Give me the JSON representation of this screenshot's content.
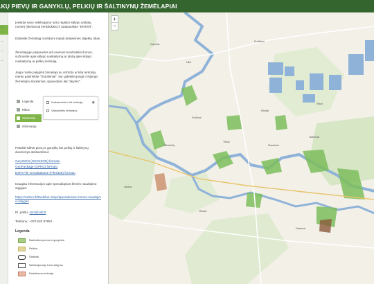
{
  "header": {
    "title": "...KŲ PIEVŲ IR GANYKLŲ, PELKIŲ IR ŠALTINYNŲ ŽEMĖLAPIAI"
  },
  "side_tabs": [
    "...",
    "...",
    "...",
    "..."
  ],
  "sidebar": {
    "p1": "Įveskite savo nekilnojamo turto registro sklypo unikalų numerį (skiriamoji ženkliukais) ir paspauskite \"ENTER\".",
    "p2": "Didinkite žemėlapį norėdami matyti detalesnes objektų ribas.",
    "p3": "Žemėlapyje paspaudus ant rausvos kvadratėlio ikonos, sužinosite apie sklypo nuskaitymą ar plotą apie sklypo nuskaitymą ar pelkių teritoriją.",
    "p4": "Jeigu norite palyginti žemėlapį su ortofoto ar kita teritorija, meniu pasirinkite \"Sluoksniai\", kur galėsite įjungti ir išjungti žemėlapio sluoksnius, spausdami akį \"akytes\".",
    "p5": "Pateikti SŽNS pievų ir ganyklų bei pelkių ir šaltinynų duomenys atsisiuntimui:",
    "link1": "GeoJSON (GEOJSON) formatu",
    "link2": "GeoPackage (GPKG) formatu",
    "link3": "ESRI File Geodatabase (FileGDB) formatu",
    "p6": "Daugiau informacijos apie specialiąsias žemės naudojimo sąlygas:",
    "link4": "https://vstt.lrv.lt/lt/veiklos-sritys/specialiosios-zemes-naudojimo-salygos",
    "email_label": "El. paštu:",
    "email": "sznt@vstt.lt",
    "phone": "Telefonu: +370 620 87952"
  },
  "mini_legend": {
    "rows": [
      "Legenda",
      "Ribos",
      "Sluoksniai",
      "Informacija"
    ],
    "popup": [
      "Kadastriniai ir kiti teritorijų",
      "Valstybinės teritorijos"
    ]
  },
  "legend": {
    "heading": "Legenda",
    "items": [
      {
        "label": "Natūralios pievos ir ganyklos",
        "color": "#a9cf82"
      },
      {
        "label": "Pelkės",
        "color": "#e3d79a"
      },
      {
        "label": "Šaltiniai",
        "color": "#ffffff"
      },
      {
        "label": "Nekilnojamojo turto sklypas",
        "color": "#ffffff"
      },
      {
        "label": "Paieškoma teritorija",
        "color": "#e9b8a6"
      }
    ]
  },
  "map": {
    "zoom_in": "+",
    "zoom_out": "−",
    "places": [
      "Kapiškis",
      "Nikė",
      "Rudiškiai",
      "Slikai",
      "Sciliūnai",
      "Mituliai",
      "Kibirkščių",
      "Tiešai",
      "Šiaudiniai",
      "Baltrūnai",
      "Varėna",
      "Vilkinai",
      "Dainavai"
    ]
  },
  "colors": {
    "header": "#34652f",
    "accent": "#7fb548",
    "water": "#a9c4d9",
    "meadow": "#a9cf82",
    "forest": "#c7dbb2"
  }
}
